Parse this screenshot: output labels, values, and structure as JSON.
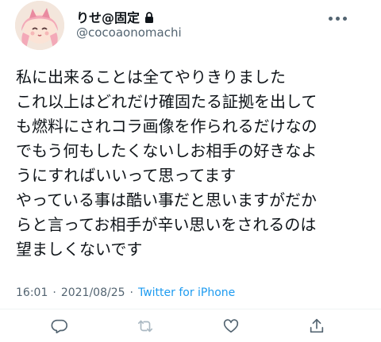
{
  "user": {
    "display_name": "りせ@固定",
    "handle": "@cocoaonomachi",
    "avatar_icon": "anime-character-avatar",
    "protected_icon": "lock-icon"
  },
  "tweet": {
    "lines": [
      "私に出来ることは全てやりきりました",
      "これ以上はどれだけ確固たる証拠を出して",
      "も燃料にされコラ画像を作られるだけなの",
      "でもう何もしたくないしお相手の好きなよ",
      "うにすればいいって思ってます",
      "やっている事は酷い事だと思いますがだか",
      "らと言ってお相手が辛い思いをされるのは",
      "望ましくないです"
    ]
  },
  "meta": {
    "time": "16:01",
    "separator1": "·",
    "date": "2021/08/25",
    "separator2": "·",
    "source": "Twitter for iPhone"
  },
  "colors": {
    "text": "#0f1419",
    "secondary": "#536471",
    "link": "#1d9bf0"
  }
}
